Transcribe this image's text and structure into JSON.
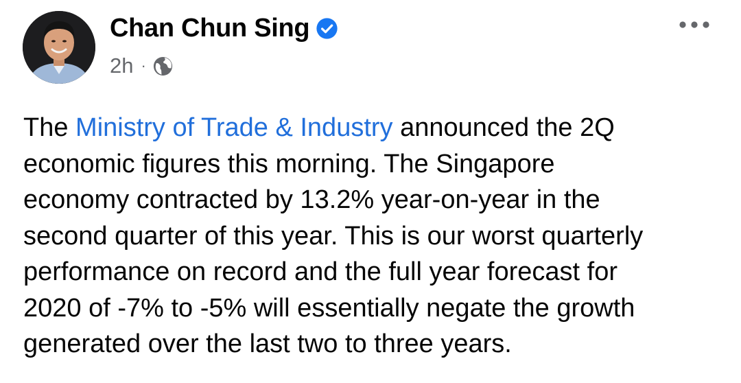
{
  "post": {
    "author": {
      "name": "Chan Chun Sing",
      "verified": true,
      "avatar_icon": "profile-photo"
    },
    "timestamp": "2h",
    "separator": "·",
    "audience_icon": "globe-icon",
    "more_icon": "more-options-icon",
    "body": {
      "line1_prefix": "The ",
      "mention": "Ministry of Trade & Industry",
      "line1_suffix": " announced the 2Q",
      "line2": "economic figures this morning. The Singapore",
      "line3": "economy contracted by 13.2% year-on-year in the",
      "line4": "second quarter of this year. This is our worst quarterly",
      "line5": "performance on record and the full year forecast for",
      "line6": "2020 of -7% to -5% will essentially negate the growth",
      "line7": "generated over the last two to three years."
    }
  },
  "colors": {
    "link": "#216fdb",
    "verified_badge": "#1877f2",
    "secondary_text": "#65676b",
    "primary_text": "#050505",
    "background": "#ffffff"
  }
}
